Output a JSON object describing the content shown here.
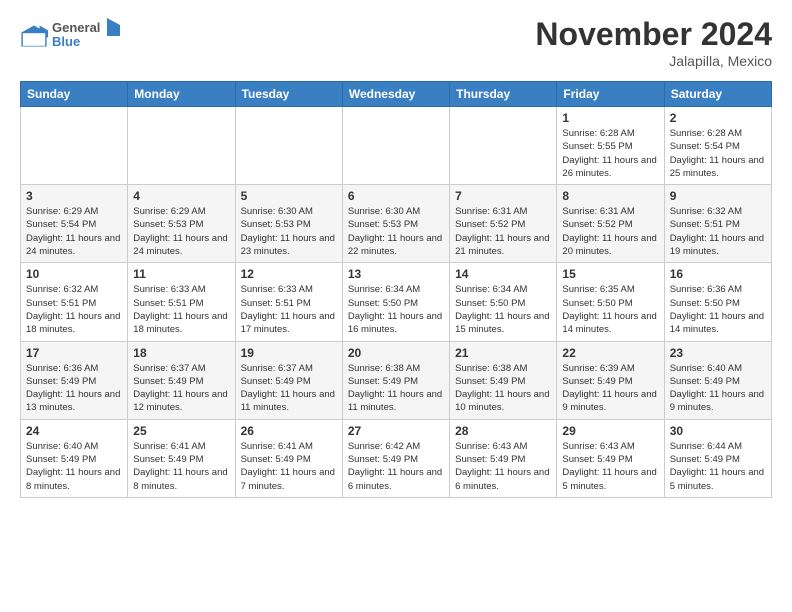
{
  "header": {
    "logo_general": "General",
    "logo_blue": "Blue",
    "month": "November 2024",
    "location": "Jalapilla, Mexico"
  },
  "days_of_week": [
    "Sunday",
    "Monday",
    "Tuesday",
    "Wednesday",
    "Thursday",
    "Friday",
    "Saturday"
  ],
  "weeks": [
    [
      {
        "day": "",
        "info": ""
      },
      {
        "day": "",
        "info": ""
      },
      {
        "day": "",
        "info": ""
      },
      {
        "day": "",
        "info": ""
      },
      {
        "day": "",
        "info": ""
      },
      {
        "day": "1",
        "info": "Sunrise: 6:28 AM\nSunset: 5:55 PM\nDaylight: 11 hours and 26 minutes."
      },
      {
        "day": "2",
        "info": "Sunrise: 6:28 AM\nSunset: 5:54 PM\nDaylight: 11 hours and 25 minutes."
      }
    ],
    [
      {
        "day": "3",
        "info": "Sunrise: 6:29 AM\nSunset: 5:54 PM\nDaylight: 11 hours and 24 minutes."
      },
      {
        "day": "4",
        "info": "Sunrise: 6:29 AM\nSunset: 5:53 PM\nDaylight: 11 hours and 24 minutes."
      },
      {
        "day": "5",
        "info": "Sunrise: 6:30 AM\nSunset: 5:53 PM\nDaylight: 11 hours and 23 minutes."
      },
      {
        "day": "6",
        "info": "Sunrise: 6:30 AM\nSunset: 5:53 PM\nDaylight: 11 hours and 22 minutes."
      },
      {
        "day": "7",
        "info": "Sunrise: 6:31 AM\nSunset: 5:52 PM\nDaylight: 11 hours and 21 minutes."
      },
      {
        "day": "8",
        "info": "Sunrise: 6:31 AM\nSunset: 5:52 PM\nDaylight: 11 hours and 20 minutes."
      },
      {
        "day": "9",
        "info": "Sunrise: 6:32 AM\nSunset: 5:51 PM\nDaylight: 11 hours and 19 minutes."
      }
    ],
    [
      {
        "day": "10",
        "info": "Sunrise: 6:32 AM\nSunset: 5:51 PM\nDaylight: 11 hours and 18 minutes."
      },
      {
        "day": "11",
        "info": "Sunrise: 6:33 AM\nSunset: 5:51 PM\nDaylight: 11 hours and 18 minutes."
      },
      {
        "day": "12",
        "info": "Sunrise: 6:33 AM\nSunset: 5:51 PM\nDaylight: 11 hours and 17 minutes."
      },
      {
        "day": "13",
        "info": "Sunrise: 6:34 AM\nSunset: 5:50 PM\nDaylight: 11 hours and 16 minutes."
      },
      {
        "day": "14",
        "info": "Sunrise: 6:34 AM\nSunset: 5:50 PM\nDaylight: 11 hours and 15 minutes."
      },
      {
        "day": "15",
        "info": "Sunrise: 6:35 AM\nSunset: 5:50 PM\nDaylight: 11 hours and 14 minutes."
      },
      {
        "day": "16",
        "info": "Sunrise: 6:36 AM\nSunset: 5:50 PM\nDaylight: 11 hours and 14 minutes."
      }
    ],
    [
      {
        "day": "17",
        "info": "Sunrise: 6:36 AM\nSunset: 5:49 PM\nDaylight: 11 hours and 13 minutes."
      },
      {
        "day": "18",
        "info": "Sunrise: 6:37 AM\nSunset: 5:49 PM\nDaylight: 11 hours and 12 minutes."
      },
      {
        "day": "19",
        "info": "Sunrise: 6:37 AM\nSunset: 5:49 PM\nDaylight: 11 hours and 11 minutes."
      },
      {
        "day": "20",
        "info": "Sunrise: 6:38 AM\nSunset: 5:49 PM\nDaylight: 11 hours and 11 minutes."
      },
      {
        "day": "21",
        "info": "Sunrise: 6:38 AM\nSunset: 5:49 PM\nDaylight: 11 hours and 10 minutes."
      },
      {
        "day": "22",
        "info": "Sunrise: 6:39 AM\nSunset: 5:49 PM\nDaylight: 11 hours and 9 minutes."
      },
      {
        "day": "23",
        "info": "Sunrise: 6:40 AM\nSunset: 5:49 PM\nDaylight: 11 hours and 9 minutes."
      }
    ],
    [
      {
        "day": "24",
        "info": "Sunrise: 6:40 AM\nSunset: 5:49 PM\nDaylight: 11 hours and 8 minutes."
      },
      {
        "day": "25",
        "info": "Sunrise: 6:41 AM\nSunset: 5:49 PM\nDaylight: 11 hours and 8 minutes."
      },
      {
        "day": "26",
        "info": "Sunrise: 6:41 AM\nSunset: 5:49 PM\nDaylight: 11 hours and 7 minutes."
      },
      {
        "day": "27",
        "info": "Sunrise: 6:42 AM\nSunset: 5:49 PM\nDaylight: 11 hours and 6 minutes."
      },
      {
        "day": "28",
        "info": "Sunrise: 6:43 AM\nSunset: 5:49 PM\nDaylight: 11 hours and 6 minutes."
      },
      {
        "day": "29",
        "info": "Sunrise: 6:43 AM\nSunset: 5:49 PM\nDaylight: 11 hours and 5 minutes."
      },
      {
        "day": "30",
        "info": "Sunrise: 6:44 AM\nSunset: 5:49 PM\nDaylight: 11 hours and 5 minutes."
      }
    ]
  ]
}
